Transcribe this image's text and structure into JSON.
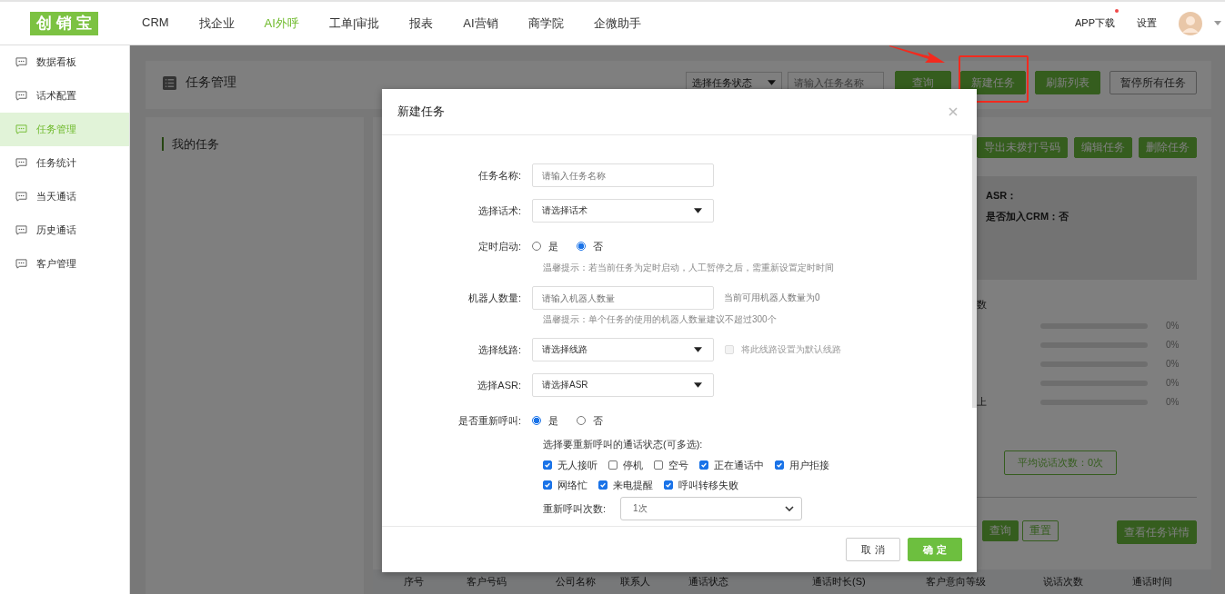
{
  "brand": {
    "logo": "创销宝"
  },
  "nav": [
    {
      "label": "CRM",
      "selected": false
    },
    {
      "label": "找企业",
      "selected": false
    },
    {
      "label": "AI外呼",
      "selected": true
    },
    {
      "label": "工单|审批",
      "selected": false
    },
    {
      "label": "报表",
      "selected": false
    },
    {
      "label": "AI营销",
      "selected": false
    },
    {
      "label": "商学院",
      "selected": false
    },
    {
      "label": "企微助手",
      "selected": false
    }
  ],
  "header_right": {
    "app_download": "APP下载",
    "has_notice": true,
    "settings": "设置"
  },
  "sidebar": {
    "items": [
      {
        "label": "数据看板",
        "selected": false
      },
      {
        "label": "话术配置",
        "selected": false
      },
      {
        "label": "任务管理",
        "selected": true
      },
      {
        "label": "任务统计",
        "selected": false
      },
      {
        "label": "当天通话",
        "selected": false
      },
      {
        "label": "历史通话",
        "selected": false
      },
      {
        "label": "客户管理",
        "selected": false
      }
    ]
  },
  "page": {
    "title": "任务管理",
    "status_filter": "选择任务状态",
    "name_search": {
      "placeholder": "请输入任务名称"
    },
    "buttons": [
      {
        "label": "查询",
        "kind": "primary",
        "highlighted": false
      },
      {
        "label": "新建任务",
        "kind": "primary",
        "highlighted": true
      },
      {
        "label": "刷新列表",
        "kind": "primary",
        "highlighted": false
      },
      {
        "label": "暂停所有任务",
        "kind": "outline",
        "highlighted": false
      }
    ]
  },
  "task_list": {
    "title": "我的任务"
  },
  "task_detail": {
    "actions": [
      "导出未拨打号码",
      "编辑任务",
      "删除任务"
    ],
    "info": [
      "ASR：",
      "是否加入CRM：否"
    ],
    "stats_heading": "数",
    "stats": [
      {
        "level": 0,
        "reading": "0%"
      },
      {
        "level": 0,
        "reading": "0%"
      },
      {
        "level": 0,
        "reading": "0%"
      },
      {
        "level": 0,
        "reading": "0%"
      },
      {
        "label": "上",
        "level": 0,
        "reading": "0%"
      }
    ],
    "average": "平均说话次数：0次",
    "query_buttons": [
      {
        "label": "查询",
        "kind": "primary"
      },
      {
        "label": "重置",
        "kind": "outline"
      }
    ],
    "details_button": "查看任务详情"
  },
  "table": {
    "columns": [
      "序号",
      "客户号码",
      "公司名称",
      "联系人",
      "通话状态",
      "通话时长(S)",
      "客户意向等级",
      "说话次数",
      "通话时间"
    ]
  },
  "dialog": {
    "title": "新建任务",
    "fields": [
      {
        "kind": "input",
        "label": "任务名称:",
        "placeholder": "请输入任务名称"
      },
      {
        "kind": "select",
        "label": "选择话术:",
        "value": "请选择话术"
      },
      {
        "kind": "radio",
        "label": "定时启动:",
        "options": [
          {
            "label": "是",
            "selected": false
          },
          {
            "label": "否",
            "selected": true
          }
        ],
        "hint": "温馨提示：若当前任务为定时启动，人工暂停之后，需重新设置定时时间"
      },
      {
        "kind": "input",
        "label": "机器人数量:",
        "placeholder": "请输入机器人数量",
        "note": "当前可用机器人数量为0",
        "hint": "温馨提示：单个任务的使用的机器人数量建议不超过300个"
      },
      {
        "kind": "select",
        "label": "选择线路:",
        "value": "请选择线路",
        "option": {
          "label": "将此线路设置为默认线路",
          "checked": false,
          "disabled": true
        }
      },
      {
        "kind": "select",
        "label": "选择ASR:",
        "value": "请选择ASR"
      },
      {
        "kind": "radio",
        "label": "是否重新呼叫:",
        "options": [
          {
            "label": "是",
            "selected": true
          },
          {
            "label": "否",
            "selected": false
          }
        ]
      }
    ],
    "redial": {
      "prompt": "选择要重新呼叫的通话状态(可多选):",
      "status_rows": [
        {
          "items": [
            {
              "label": "无人接听",
              "checked": true
            },
            {
              "label": "停机",
              "checked": false
            },
            {
              "label": "空号",
              "checked": false
            },
            {
              "label": "正在通话中",
              "checked": true
            },
            {
              "label": "用户拒接",
              "checked": true
            }
          ]
        },
        {
          "items": [
            {
              "label": "网络忙",
              "checked": true
            },
            {
              "label": "来电提醒",
              "checked": true
            },
            {
              "label": "呼叫转移失败",
              "checked": true
            }
          ]
        }
      ],
      "count_label": "重新呼叫次数:",
      "count": "1次"
    },
    "buttons": [
      {
        "label": "取 消",
        "kind": "default"
      },
      {
        "label": "确 定",
        "kind": "primary"
      }
    ]
  }
}
